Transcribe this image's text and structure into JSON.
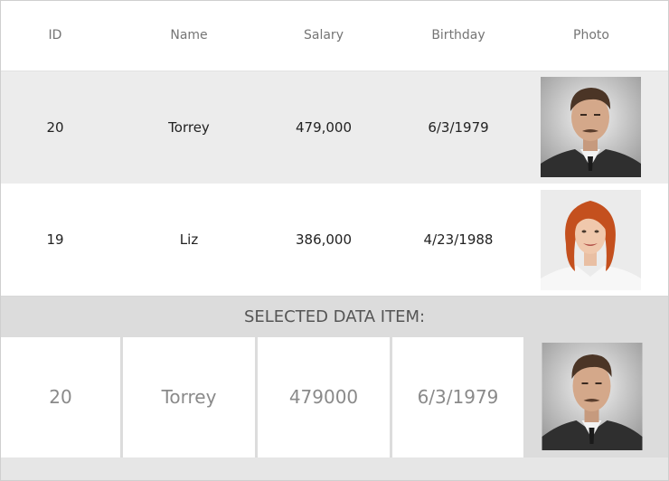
{
  "columns": {
    "id": "ID",
    "name": "Name",
    "salary": "Salary",
    "birthday": "Birthday",
    "photo": "Photo"
  },
  "rows": [
    {
      "id": "20",
      "name": "Torrey",
      "salary": "479,000",
      "birthday": "6/3/1979",
      "photo_icon": "man-portrait-photo"
    },
    {
      "id": "19",
      "name": "Liz",
      "salary": "386,000",
      "birthday": "4/23/1988",
      "photo_icon": "woman-portrait-photo"
    }
  ],
  "selected": {
    "title": "SELECTED DATA ITEM:",
    "id": "20",
    "name": "Torrey",
    "salary": "479000",
    "birthday": "6/3/1979",
    "photo_icon": "man-portrait-photo"
  },
  "colors": {
    "row_alt": "#ececec",
    "selected_bg": "#dcdcdc",
    "header_text": "#757575"
  }
}
